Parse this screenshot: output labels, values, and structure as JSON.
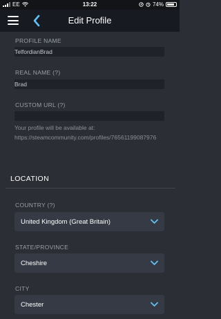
{
  "status_bar": {
    "carrier": "EE",
    "time": "13:22",
    "battery": "74%"
  },
  "header": {
    "title": "Edit Profile"
  },
  "fields": {
    "profile_name": {
      "label": "PROFILE NAME",
      "value": "TelfordianBrad"
    },
    "real_name": {
      "label": "REAL NAME (?)",
      "value": "Brad"
    },
    "custom_url": {
      "label": "CUSTOM URL (?)",
      "value": "",
      "hint_line1": "Your profile will be available at:",
      "hint_line2": "https://steamcommunity.com/profiles/76561199087976"
    }
  },
  "location": {
    "title": "LOCATION",
    "country": {
      "label": "COUNTRY (?)",
      "value": "United Kingdom (Great Britain)"
    },
    "state": {
      "label": "STATE/PROVINCE",
      "value": "Cheshire"
    },
    "city": {
      "label": "CITY",
      "value": "Chester"
    }
  },
  "colors": {
    "background": "#2b2e35",
    "topbar": "#171a21",
    "accent_blue": "#66c0f4"
  }
}
